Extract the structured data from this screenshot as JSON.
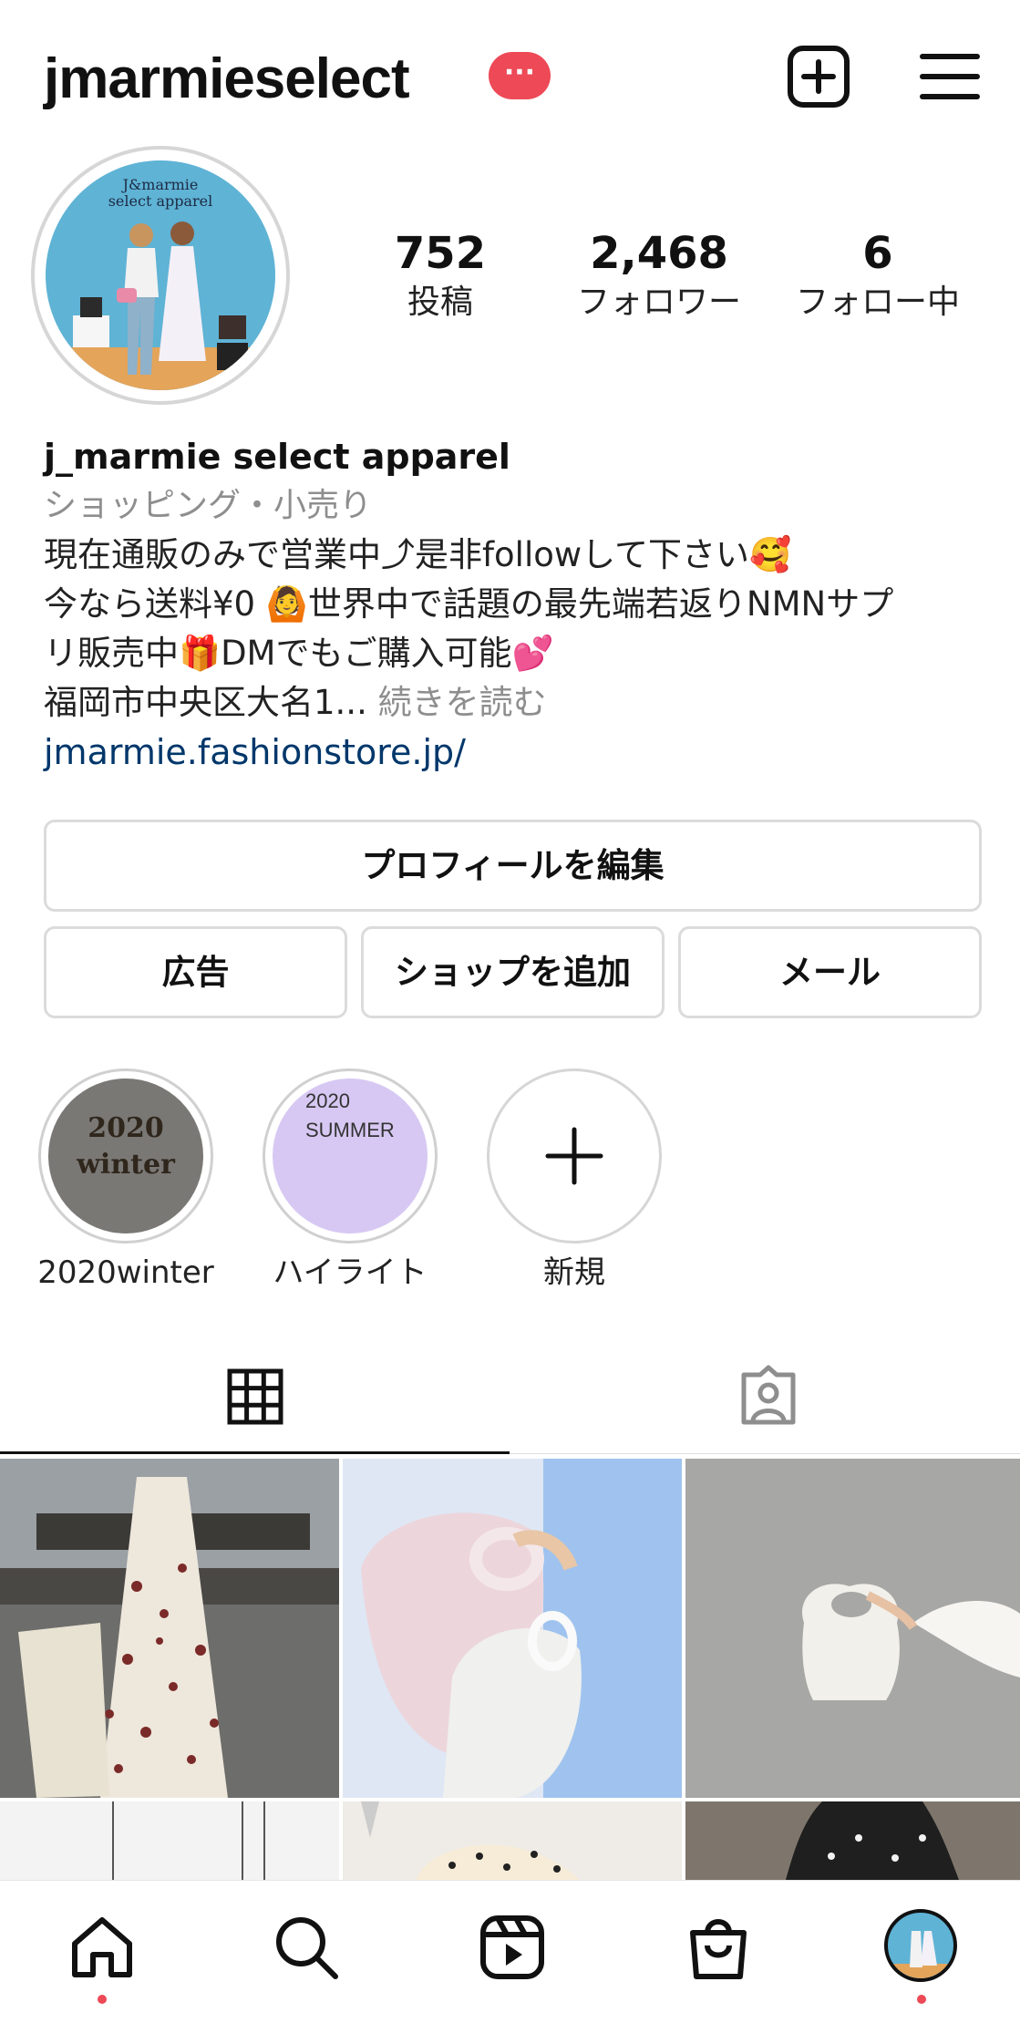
{
  "header": {
    "username": "jmarmieselect",
    "badge": "···",
    "icons": {
      "new_post": "plus-square-icon",
      "menu": "hamburger-menu-icon"
    }
  },
  "profile": {
    "avatar_text_line1": "J&marmie",
    "avatar_text_line2": "select apparel",
    "stats": [
      {
        "value": "752",
        "label": "投稿"
      },
      {
        "value": "2,468",
        "label": "フォロワー"
      },
      {
        "value": "6",
        "label": "フォロー中"
      }
    ],
    "display_name": "j_marmie select apparel",
    "category": "ショッピング・小売り",
    "bio_line1": "現在通販のみで営業中⤴是非followして下さい🥰",
    "bio_line2": " 今なら送料¥0 🙆世界中で話題の最先端若返りNMNサプ",
    "bio_line3": "リ販売中🎁DMでもご購入可能💕",
    "bio_line4": "福岡市中央区大名1...",
    "bio_more": " 続きを読む",
    "link": "jmarmie.fashionstore.jp/"
  },
  "buttons": {
    "edit_profile": "プロフィールを編集",
    "ads": "広告",
    "add_shop": "ショップを追加",
    "email": "メール"
  },
  "highlights": [
    {
      "label": "2020winter",
      "cover_text_line1": "2020",
      "cover_text_line2": "winter",
      "color": "#7a7875"
    },
    {
      "label": "ハイライト",
      "cover_text_line1": "2020",
      "cover_text_line2": "SUMMER",
      "color": "#d7c8f3"
    },
    {
      "label": "新規",
      "cover_text_line1": "+",
      "cover_text_line2": "",
      "color": "#ffffff"
    }
  ],
  "tabs": {
    "grid": "grid-icon",
    "tagged": "tagged-person-icon"
  },
  "colors": {
    "accent_red": "#ed4956",
    "link_blue": "#00376b",
    "muted": "#8e8e8e",
    "border": "#dbdbdb"
  },
  "bottom_nav": [
    "home-icon",
    "search-icon",
    "reels-icon",
    "shop-icon",
    "profile-avatar-icon"
  ]
}
